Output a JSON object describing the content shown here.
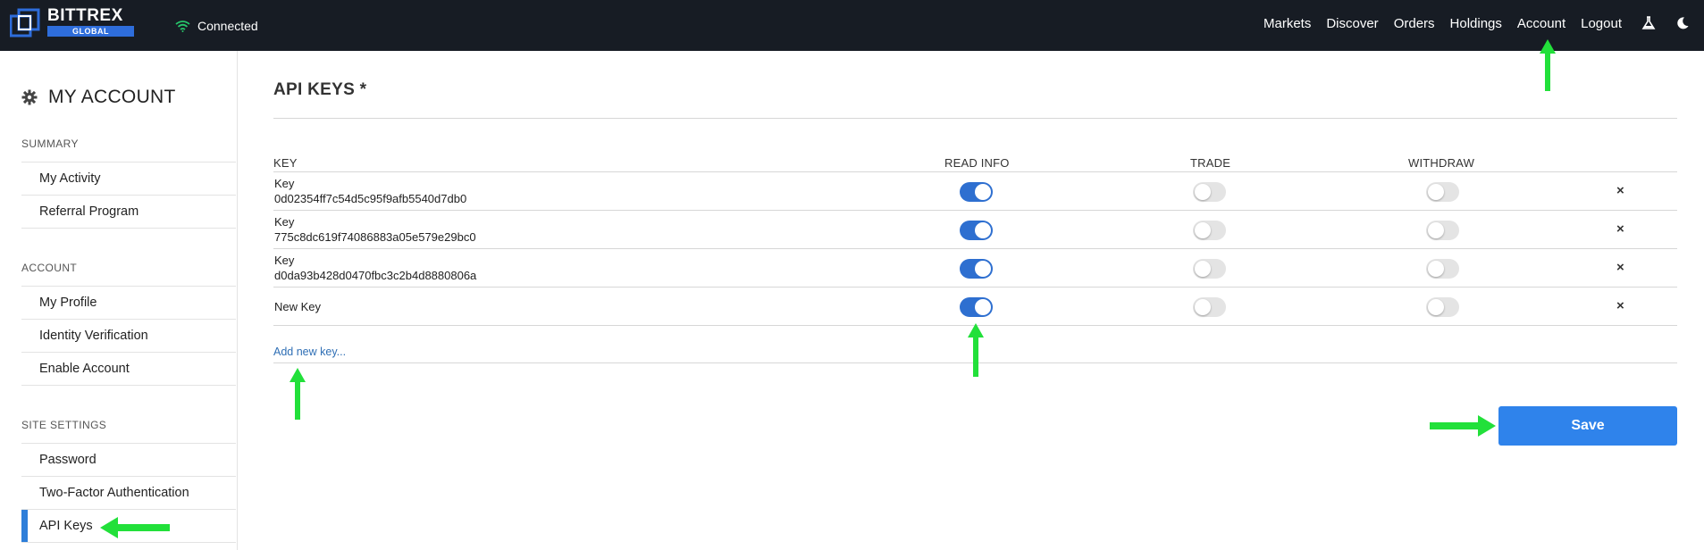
{
  "header": {
    "brand": "BITTREX",
    "brand_sub": "GLOBAL",
    "connection_status": "Connected",
    "nav": [
      "Markets",
      "Discover",
      "Orders",
      "Holdings",
      "Account",
      "Logout"
    ],
    "icons": [
      "flask-icon",
      "moon-icon"
    ]
  },
  "sidebar": {
    "title": "MY ACCOUNT",
    "sections": [
      {
        "label": "SUMMARY",
        "items": [
          "My Activity",
          "Referral Program"
        ]
      },
      {
        "label": "ACCOUNT",
        "items": [
          "My Profile",
          "Identity Verification",
          "Enable Account"
        ]
      },
      {
        "label": "SITE SETTINGS",
        "items": [
          "Password",
          "Two-Factor Authentication",
          "API Keys"
        ]
      }
    ],
    "active_item": "API Keys"
  },
  "main": {
    "title": "API KEYS *",
    "columns": [
      "KEY",
      "READ INFO",
      "TRADE",
      "WITHDRAW"
    ],
    "rows": [
      {
        "label": "Key",
        "key": "0d02354ff7c54d5c95f9afb5540d7db0",
        "read_info": true,
        "trade": false,
        "withdraw": false
      },
      {
        "label": "Key",
        "key": "775c8dc619f74086883a05e579e29bc0",
        "read_info": true,
        "trade": false,
        "withdraw": false
      },
      {
        "label": "Key",
        "key": "d0da93b428d0470fbc3c2b4d8880806a",
        "read_info": true,
        "trade": false,
        "withdraw": false
      },
      {
        "label": "New Key",
        "key": "",
        "read_info": true,
        "trade": false,
        "withdraw": false
      }
    ],
    "delete_glyph": "×",
    "add_link": "Add new key...",
    "save_label": "Save"
  },
  "colors": {
    "topbar": "#171c24",
    "accent": "#2e6fd0",
    "save_button": "#2f83eb",
    "annotation_arrow": "#22e03a"
  }
}
